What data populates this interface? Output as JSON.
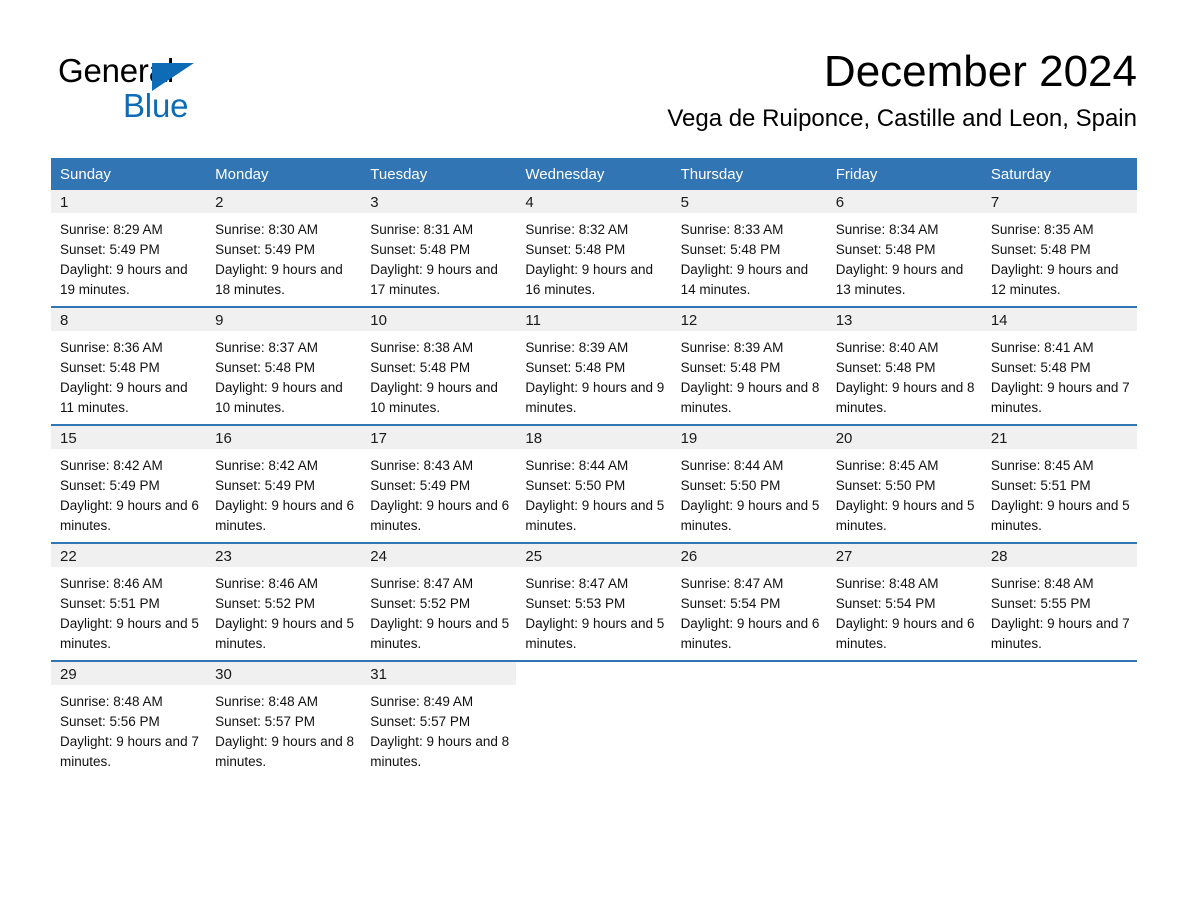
{
  "brand": {
    "name_part1": "General",
    "name_part2": "Blue",
    "triangle_icon": "triangle-logo-icon",
    "accent_color": "#0d6cb5"
  },
  "header": {
    "title": "December 2024",
    "subtitle": "Vega de Ruiponce, Castille and Leon, Spain"
  },
  "colors": {
    "header_blue": "#3175b5",
    "date_band_gray": "#f0f0f0",
    "row_divider_blue": "#3175b5",
    "text": "#000000"
  },
  "calendar": {
    "weekday_headers": [
      "Sunday",
      "Monday",
      "Tuesday",
      "Wednesday",
      "Thursday",
      "Friday",
      "Saturday"
    ],
    "weeks": [
      [
        {
          "day": "1",
          "sunrise": "Sunrise: 8:29 AM",
          "sunset": "Sunset: 5:49 PM",
          "daylight": "Daylight: 9 hours and 19 minutes."
        },
        {
          "day": "2",
          "sunrise": "Sunrise: 8:30 AM",
          "sunset": "Sunset: 5:49 PM",
          "daylight": "Daylight: 9 hours and 18 minutes."
        },
        {
          "day": "3",
          "sunrise": "Sunrise: 8:31 AM",
          "sunset": "Sunset: 5:48 PM",
          "daylight": "Daylight: 9 hours and 17 minutes."
        },
        {
          "day": "4",
          "sunrise": "Sunrise: 8:32 AM",
          "sunset": "Sunset: 5:48 PM",
          "daylight": "Daylight: 9 hours and 16 minutes."
        },
        {
          "day": "5",
          "sunrise": "Sunrise: 8:33 AM",
          "sunset": "Sunset: 5:48 PM",
          "daylight": "Daylight: 9 hours and 14 minutes."
        },
        {
          "day": "6",
          "sunrise": "Sunrise: 8:34 AM",
          "sunset": "Sunset: 5:48 PM",
          "daylight": "Daylight: 9 hours and 13 minutes."
        },
        {
          "day": "7",
          "sunrise": "Sunrise: 8:35 AM",
          "sunset": "Sunset: 5:48 PM",
          "daylight": "Daylight: 9 hours and 12 minutes."
        }
      ],
      [
        {
          "day": "8",
          "sunrise": "Sunrise: 8:36 AM",
          "sunset": "Sunset: 5:48 PM",
          "daylight": "Daylight: 9 hours and 11 minutes."
        },
        {
          "day": "9",
          "sunrise": "Sunrise: 8:37 AM",
          "sunset": "Sunset: 5:48 PM",
          "daylight": "Daylight: 9 hours and 10 minutes."
        },
        {
          "day": "10",
          "sunrise": "Sunrise: 8:38 AM",
          "sunset": "Sunset: 5:48 PM",
          "daylight": "Daylight: 9 hours and 10 minutes."
        },
        {
          "day": "11",
          "sunrise": "Sunrise: 8:39 AM",
          "sunset": "Sunset: 5:48 PM",
          "daylight": "Daylight: 9 hours and 9 minutes."
        },
        {
          "day": "12",
          "sunrise": "Sunrise: 8:39 AM",
          "sunset": "Sunset: 5:48 PM",
          "daylight": "Daylight: 9 hours and 8 minutes."
        },
        {
          "day": "13",
          "sunrise": "Sunrise: 8:40 AM",
          "sunset": "Sunset: 5:48 PM",
          "daylight": "Daylight: 9 hours and 8 minutes."
        },
        {
          "day": "14",
          "sunrise": "Sunrise: 8:41 AM",
          "sunset": "Sunset: 5:48 PM",
          "daylight": "Daylight: 9 hours and 7 minutes."
        }
      ],
      [
        {
          "day": "15",
          "sunrise": "Sunrise: 8:42 AM",
          "sunset": "Sunset: 5:49 PM",
          "daylight": "Daylight: 9 hours and 6 minutes."
        },
        {
          "day": "16",
          "sunrise": "Sunrise: 8:42 AM",
          "sunset": "Sunset: 5:49 PM",
          "daylight": "Daylight: 9 hours and 6 minutes."
        },
        {
          "day": "17",
          "sunrise": "Sunrise: 8:43 AM",
          "sunset": "Sunset: 5:49 PM",
          "daylight": "Daylight: 9 hours and 6 minutes."
        },
        {
          "day": "18",
          "sunrise": "Sunrise: 8:44 AM",
          "sunset": "Sunset: 5:50 PM",
          "daylight": "Daylight: 9 hours and 5 minutes."
        },
        {
          "day": "19",
          "sunrise": "Sunrise: 8:44 AM",
          "sunset": "Sunset: 5:50 PM",
          "daylight": "Daylight: 9 hours and 5 minutes."
        },
        {
          "day": "20",
          "sunrise": "Sunrise: 8:45 AM",
          "sunset": "Sunset: 5:50 PM",
          "daylight": "Daylight: 9 hours and 5 minutes."
        },
        {
          "day": "21",
          "sunrise": "Sunrise: 8:45 AM",
          "sunset": "Sunset: 5:51 PM",
          "daylight": "Daylight: 9 hours and 5 minutes."
        }
      ],
      [
        {
          "day": "22",
          "sunrise": "Sunrise: 8:46 AM",
          "sunset": "Sunset: 5:51 PM",
          "daylight": "Daylight: 9 hours and 5 minutes."
        },
        {
          "day": "23",
          "sunrise": "Sunrise: 8:46 AM",
          "sunset": "Sunset: 5:52 PM",
          "daylight": "Daylight: 9 hours and 5 minutes."
        },
        {
          "day": "24",
          "sunrise": "Sunrise: 8:47 AM",
          "sunset": "Sunset: 5:52 PM",
          "daylight": "Daylight: 9 hours and 5 minutes."
        },
        {
          "day": "25",
          "sunrise": "Sunrise: 8:47 AM",
          "sunset": "Sunset: 5:53 PM",
          "daylight": "Daylight: 9 hours and 5 minutes."
        },
        {
          "day": "26",
          "sunrise": "Sunrise: 8:47 AM",
          "sunset": "Sunset: 5:54 PM",
          "daylight": "Daylight: 9 hours and 6 minutes."
        },
        {
          "day": "27",
          "sunrise": "Sunrise: 8:48 AM",
          "sunset": "Sunset: 5:54 PM",
          "daylight": "Daylight: 9 hours and 6 minutes."
        },
        {
          "day": "28",
          "sunrise": "Sunrise: 8:48 AM",
          "sunset": "Sunset: 5:55 PM",
          "daylight": "Daylight: 9 hours and 7 minutes."
        }
      ],
      [
        {
          "day": "29",
          "sunrise": "Sunrise: 8:48 AM",
          "sunset": "Sunset: 5:56 PM",
          "daylight": "Daylight: 9 hours and 7 minutes."
        },
        {
          "day": "30",
          "sunrise": "Sunrise: 8:48 AM",
          "sunset": "Sunset: 5:57 PM",
          "daylight": "Daylight: 9 hours and 8 minutes."
        },
        {
          "day": "31",
          "sunrise": "Sunrise: 8:49 AM",
          "sunset": "Sunset: 5:57 PM",
          "daylight": "Daylight: 9 hours and 8 minutes."
        },
        {
          "day": "",
          "sunrise": "",
          "sunset": "",
          "daylight": ""
        },
        {
          "day": "",
          "sunrise": "",
          "sunset": "",
          "daylight": ""
        },
        {
          "day": "",
          "sunrise": "",
          "sunset": "",
          "daylight": ""
        },
        {
          "day": "",
          "sunrise": "",
          "sunset": "",
          "daylight": ""
        }
      ]
    ]
  }
}
